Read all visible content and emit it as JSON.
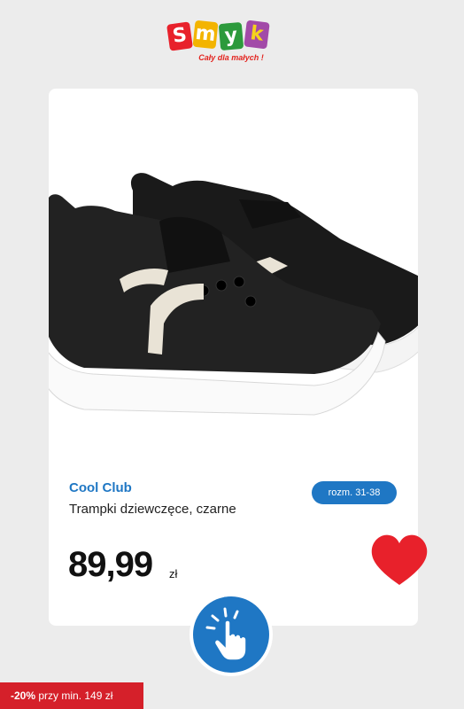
{
  "logo": {
    "letters": [
      "S",
      "m",
      "y",
      "k"
    ],
    "tagline": "Cały dla małych !"
  },
  "product": {
    "brand": "Cool Club",
    "name": "Trampki dziewczęce, czarne",
    "size": "rozm. 31-38",
    "price": "89,99",
    "currency": "zł"
  },
  "promo": {
    "discount": "-20%",
    "text": "przy min. 149 zł"
  },
  "icons": {
    "favorite": "heart-icon",
    "tap": "tap-hand-icon"
  },
  "colors": {
    "accent": "#1f77c4",
    "heart": "#e8212b",
    "promo_bg": "#d5202a"
  }
}
